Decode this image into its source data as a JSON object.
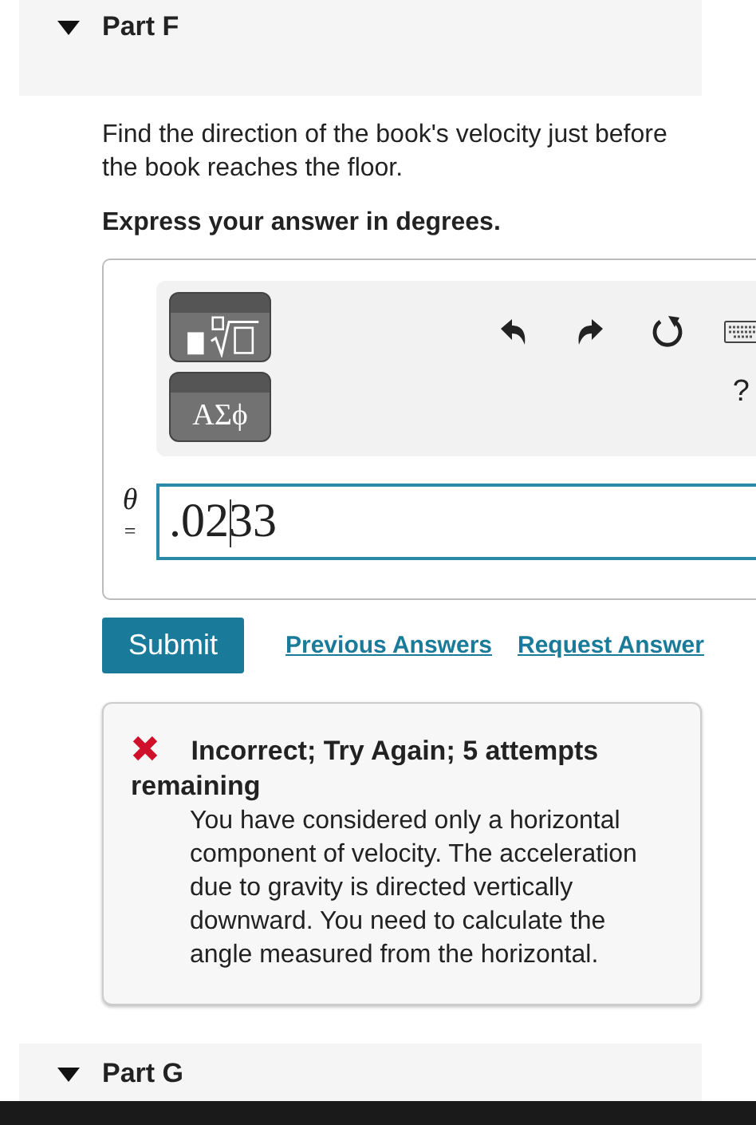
{
  "part_f": {
    "title": "Part F",
    "expanded": true
  },
  "question": "Find the direction of the book's velocity just before the book reaches the floor.",
  "instruction": "Express your answer in degrees.",
  "toolbar": {
    "symbols_button": "ΑΣϕ",
    "help": "?"
  },
  "answer": {
    "variable": "θ",
    "equals": "=",
    "value": ".0233"
  },
  "actions": {
    "submit": "Submit",
    "links": [
      "Previous Answers",
      "Request Answer"
    ]
  },
  "feedback": {
    "correct": false,
    "title": "Incorrect; Try Again; 5 attempts remaining",
    "message": "You have considered only a horizontal component of velocity. The acceleration due to gravity is directed vertically downward. You need to calculate the angle measured from the horizontal."
  },
  "part_g": {
    "title": "Part G",
    "expanded": true
  }
}
